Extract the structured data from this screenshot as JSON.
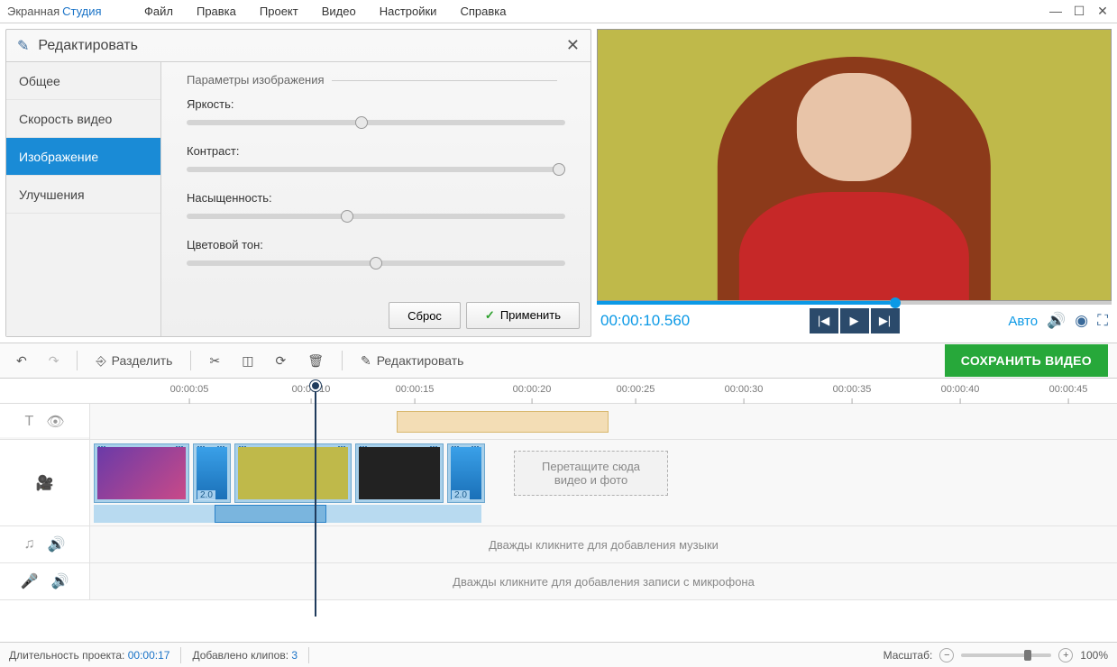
{
  "app": {
    "name1": "Экранная",
    "name2": "Студия"
  },
  "menu": {
    "file": "Файл",
    "edit": "Правка",
    "project": "Проект",
    "video": "Видео",
    "settings": "Настройки",
    "help": "Справка"
  },
  "edit_panel": {
    "title": "Редактировать",
    "close": "✕",
    "tabs": {
      "general": "Общее",
      "speed": "Скорость видео",
      "image": "Изображение",
      "improvements": "Улучшения"
    },
    "section": "Параметры изображения",
    "sliders": {
      "brightness": "Яркость:",
      "contrast": "Контраст:",
      "saturation": "Насыщенность:",
      "hue": "Цветовой тон:"
    },
    "reset": "Сброс",
    "apply": "Применить"
  },
  "preview": {
    "time": "00:00:10.560",
    "auto": "Авто"
  },
  "toolbar": {
    "split": "Разделить",
    "edit": "Редактировать",
    "save": "СОХРАНИТЬ ВИДЕО"
  },
  "ruler": {
    "t05": "00:00:05",
    "t10": "00:00:10",
    "t15": "00:00:15",
    "t20": "00:00:20",
    "t25": "00:00:25",
    "t30": "00:00:30",
    "t35": "00:00:35",
    "t40": "00:00:40",
    "t45": "00:00:45"
  },
  "timeline": {
    "drop_hint1": "Перетащите сюда",
    "drop_hint2": "видео и фото",
    "music_hint": "Дважды кликните для добавления музыки",
    "mic_hint": "Дважды кликните для добавления записи с микрофона",
    "dur": "2.0"
  },
  "status": {
    "duration_label": "Длительность проекта:",
    "duration_value": "00:00:17",
    "clips_label": "Добавлено клипов:",
    "clips_value": "3",
    "zoom_label": "Масштаб:",
    "zoom_value": "100%"
  }
}
